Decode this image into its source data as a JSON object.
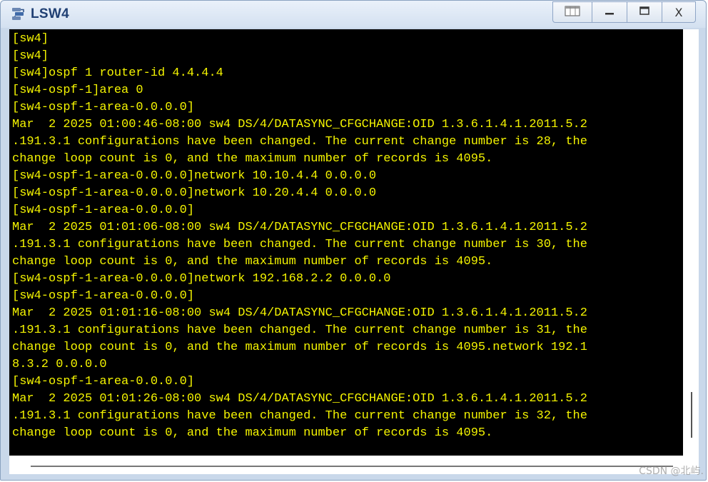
{
  "window": {
    "title": "LSW4",
    "buttons": {
      "restore_glyph": "▭",
      "minimize_glyph": "–",
      "maximize_glyph": "☐",
      "close_glyph": "X"
    },
    "icons": [
      "network-switch-icon",
      "restore-icon",
      "minimize-icon",
      "maximize-icon",
      "close-icon"
    ]
  },
  "terminal": {
    "text_color": "#f4f400",
    "background": "#000000",
    "lines": [
      "[sw4]",
      "[sw4]",
      "[sw4]ospf 1 router-id 4.4.4.4",
      "[sw4-ospf-1]area 0",
      "[sw4-ospf-1-area-0.0.0.0]",
      "Mar  2 2025 01:00:46-08:00 sw4 DS/4/DATASYNC_CFGCHANGE:OID 1.3.6.1.4.1.2011.5.2",
      ".191.3.1 configurations have been changed. The current change number is 28, the",
      "change loop count is 0, and the maximum number of records is 4095.",
      "[sw4-ospf-1-area-0.0.0.0]network 10.10.4.4 0.0.0.0",
      "[sw4-ospf-1-area-0.0.0.0]network 10.20.4.4 0.0.0.0",
      "[sw4-ospf-1-area-0.0.0.0]",
      "Mar  2 2025 01:01:06-08:00 sw4 DS/4/DATASYNC_CFGCHANGE:OID 1.3.6.1.4.1.2011.5.2",
      ".191.3.1 configurations have been changed. The current change number is 30, the",
      "change loop count is 0, and the maximum number of records is 4095.",
      "[sw4-ospf-1-area-0.0.0.0]network 192.168.2.2 0.0.0.0",
      "[sw4-ospf-1-area-0.0.0.0]",
      "Mar  2 2025 01:01:16-08:00 sw4 DS/4/DATASYNC_CFGCHANGE:OID 1.3.6.1.4.1.2011.5.2",
      ".191.3.1 configurations have been changed. The current change number is 31, the",
      "change loop count is 0, and the maximum number of records is 4095.network 192.1",
      "8.3.2 0.0.0.0",
      "[sw4-ospf-1-area-0.0.0.0]",
      "Mar  2 2025 01:01:26-08:00 sw4 DS/4/DATASYNC_CFGCHANGE:OID 1.3.6.1.4.1.2011.5.2",
      ".191.3.1 configurations have been changed. The current change number is 32, the",
      "change loop count is 0, and the maximum number of records is 4095."
    ]
  },
  "watermark": "CSDN @北屿."
}
